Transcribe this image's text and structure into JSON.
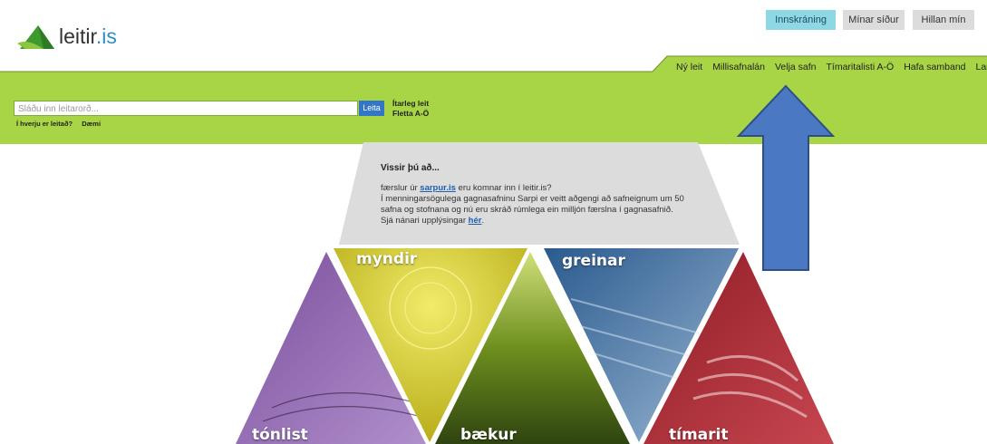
{
  "header": {
    "logo_text": "leitir",
    "logo_tld": ".is",
    "buttons": {
      "login": "Innskráning",
      "my_pages": "Mínar síður",
      "my_shelf": "Hillan mín"
    }
  },
  "nav": {
    "items": [
      "Ný leit",
      "Millisafnalán",
      "Velja safn",
      "Tímaritalisti A-Ö",
      "Hafa samband",
      "Langua"
    ]
  },
  "search": {
    "placeholder": "Sláðu inn leitarorð...",
    "button": "Leita",
    "advanced": "Ítarleg leit",
    "browse": "Fletta A-Ö",
    "help_where": "Í hverju er leitað?",
    "help_examples": "Dæmi"
  },
  "info": {
    "title": "Vissir þú að...",
    "line1_pre": "færslur úr ",
    "line1_link": "sarpur.is",
    "line1_post": " eru komnar inn í leitir.is?",
    "line2": "Í menningarsögulega gagnasafninu Sarpi er veitt aðgengi að safneignum um 50",
    "line3": "safna og stofnana og nú eru skráð rúmlega ein milljón færslna í gagnasafnið.",
    "line4_pre": "Sjá nánari upplýsingar ",
    "line4_link": "hér",
    "line4_post": "."
  },
  "categories": {
    "music": "tónlist",
    "images": "myndir",
    "books": "bækur",
    "articles": "greinar",
    "journals": "tímarit"
  },
  "colors": {
    "band": "#a8d545",
    "button_blue": "#3375c6",
    "login_btn": "#8ed8e6",
    "arrow": "#4a78c2"
  }
}
